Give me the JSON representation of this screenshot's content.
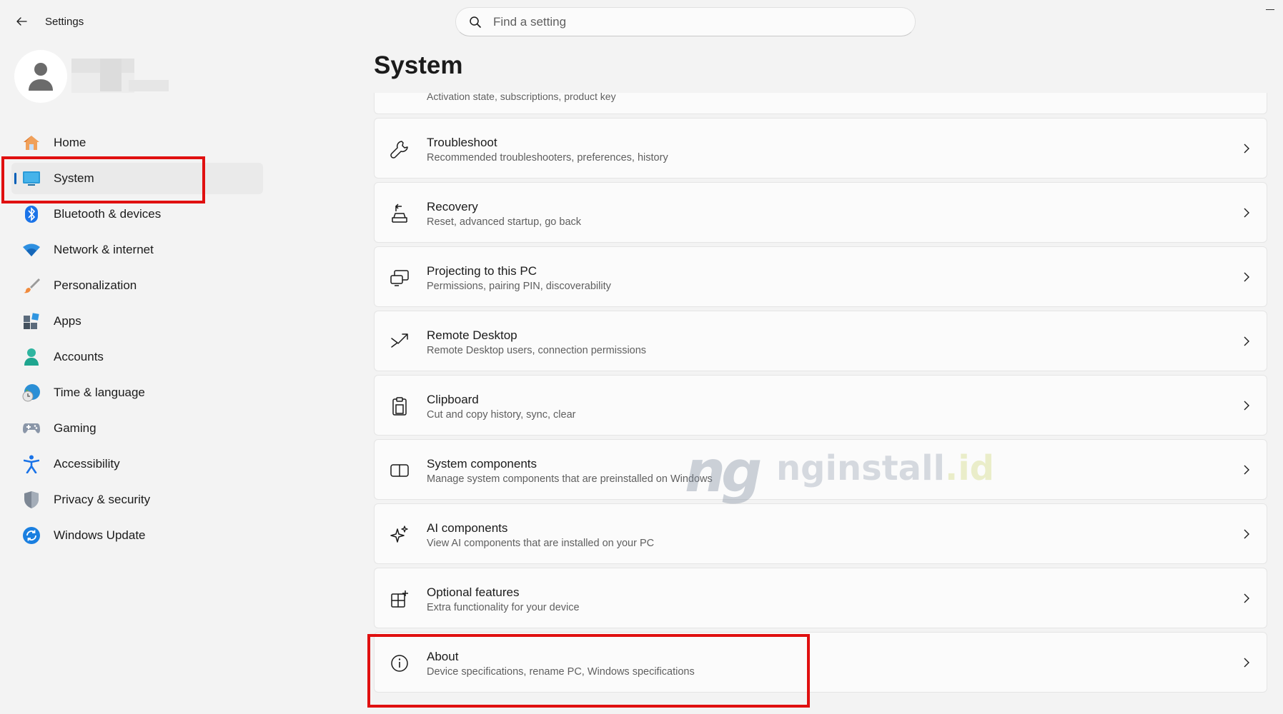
{
  "window": {
    "title": "Settings"
  },
  "search": {
    "placeholder": "Find a setting"
  },
  "sidebar": {
    "items": [
      {
        "label": "Home",
        "icon": "home-icon",
        "selected": false
      },
      {
        "label": "System",
        "icon": "system-monitor-icon",
        "selected": true
      },
      {
        "label": "Bluetooth & devices",
        "icon": "bluetooth-icon",
        "selected": false
      },
      {
        "label": "Network & internet",
        "icon": "wifi-icon",
        "selected": false
      },
      {
        "label": "Personalization",
        "icon": "brush-icon",
        "selected": false
      },
      {
        "label": "Apps",
        "icon": "apps-icon",
        "selected": false
      },
      {
        "label": "Accounts",
        "icon": "accounts-icon",
        "selected": false
      },
      {
        "label": "Time & language",
        "icon": "globe-clock-icon",
        "selected": false
      },
      {
        "label": "Gaming",
        "icon": "gamepad-icon",
        "selected": false
      },
      {
        "label": "Accessibility",
        "icon": "accessibility-icon",
        "selected": false
      },
      {
        "label": "Privacy & security",
        "icon": "shield-icon",
        "selected": false
      },
      {
        "label": "Windows Update",
        "icon": "update-icon",
        "selected": false
      }
    ]
  },
  "main": {
    "title": "System",
    "partial_desc": "Activation state, subscriptions, product key",
    "cards": [
      {
        "title": "Troubleshoot",
        "desc": "Recommended troubleshooters, preferences, history",
        "icon": "wrench-icon"
      },
      {
        "title": "Recovery",
        "desc": "Reset, advanced startup, go back",
        "icon": "recovery-icon"
      },
      {
        "title": "Projecting to this PC",
        "desc": "Permissions, pairing PIN, discoverability",
        "icon": "projector-icon"
      },
      {
        "title": "Remote Desktop",
        "desc": "Remote Desktop users, connection permissions",
        "icon": "remote-desktop-icon"
      },
      {
        "title": "Clipboard",
        "desc": "Cut and copy history, sync, clear",
        "icon": "clipboard-icon"
      },
      {
        "title": "System components",
        "desc": "Manage system components that are preinstalled on Windows",
        "icon": "components-icon"
      },
      {
        "title": "AI components",
        "desc": "View AI components that are installed on your PC",
        "icon": "sparkle-icon"
      },
      {
        "title": "Optional features",
        "desc": "Extra functionality for your device",
        "icon": "optional-features-icon"
      },
      {
        "title": "About",
        "desc": "Device specifications, rename PC, Windows specifications",
        "icon": "info-icon"
      }
    ]
  },
  "watermark": {
    "brand": "ng",
    "text": "nginstall",
    "suffix": ".id"
  },
  "colors": {
    "accent": "#005fb8",
    "highlight": "#e01010"
  }
}
